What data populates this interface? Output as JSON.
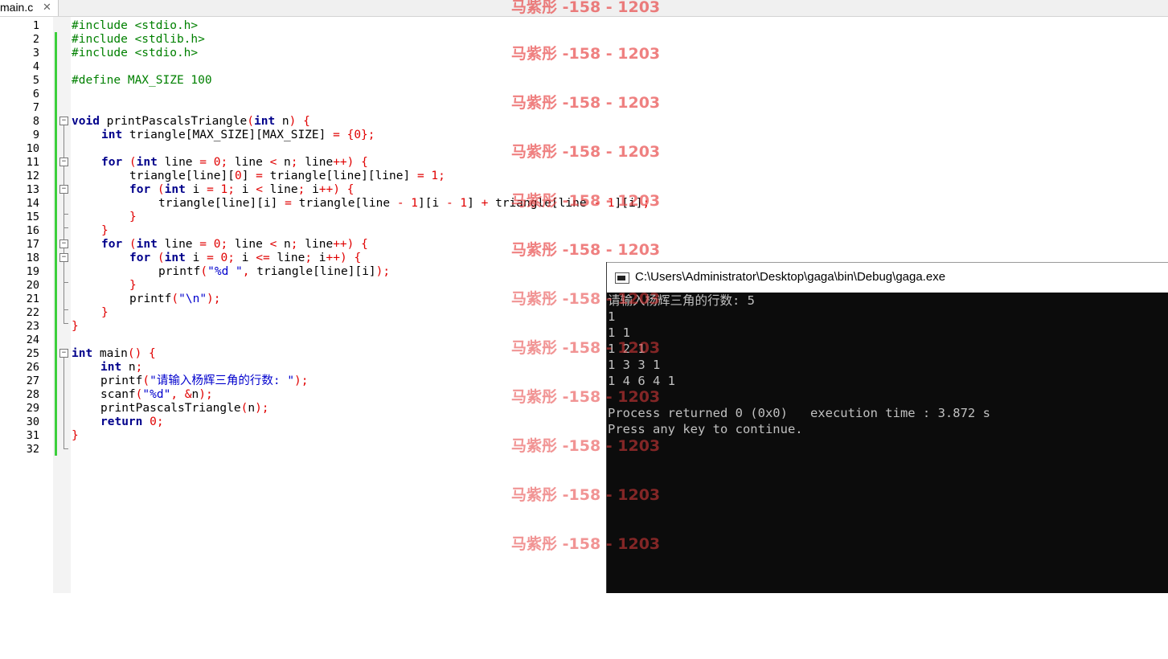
{
  "tab": {
    "filename": "main.c",
    "close": "✕"
  },
  "line_numbers": [
    "1",
    "2",
    "3",
    "4",
    "5",
    "6",
    "7",
    "8",
    "9",
    "10",
    "11",
    "12",
    "13",
    "14",
    "15",
    "16",
    "17",
    "18",
    "19",
    "20",
    "21",
    "22",
    "23",
    "24",
    "25",
    "26",
    "27",
    "28",
    "29",
    "30",
    "31",
    "32"
  ],
  "code": {
    "l1": "#include <stdio.h>",
    "l2": "#include <stdlib.h>",
    "l3": "#include <stdio.h>",
    "l5": "#define MAX_SIZE 100",
    "l8_kw": "void",
    "l8_fn": " printPascalsTriangle",
    "l8_p1": "(",
    "l8_kw2": "int",
    "l8_rest": " n",
    "l8_p2": ") {",
    "l9_kw": "int",
    "l9_a": " triangle[MAX_SIZE][MAX_SIZE] ",
    "l9_b": "= {",
    "l9_n": "0",
    "l9_c": "};",
    "l11_kw": "for",
    "l11_a": " (",
    "l11_kw2": "int",
    "l11_b": " line ",
    "l11_c": "=",
    "l11_n": " 0",
    "l11_d": ";",
    "l11_e": " line ",
    "l11_f": "<",
    "l11_g": " n",
    "l11_h": ";",
    "l11_i": " line",
    "l11_j": "++) {",
    "l12_a": "triangle[line][",
    "l12_n": "0",
    "l12_b": "] ",
    "l12_c": "=",
    "l12_d": " triangle[line][line] ",
    "l12_e": "=",
    "l12_f": " 1",
    "l12_g": ";",
    "l13_kw": "for",
    "l13_a": " (",
    "l13_kw2": "int",
    "l13_b": " i ",
    "l13_c": "=",
    "l13_d": " 1",
    "l13_e": ";",
    "l13_f": " i ",
    "l13_g": "<",
    "l13_h": " line",
    "l13_i": ";",
    "l13_j": " i",
    "l13_k": "++) {",
    "l14_a": "triangle[line][i] ",
    "l14_b": "=",
    "l14_c": " triangle[line ",
    "l14_d": "- 1",
    "l14_e": "][i ",
    "l14_f": "- 1",
    "l14_g": "] ",
    "l14_h": "+",
    "l14_i": " triangle[line ",
    "l14_j": "- 1",
    "l14_k": "][i]",
    "l14_l": ";",
    "l15": "}",
    "l16": "}",
    "l17_kw": "for",
    "l17_a": " (",
    "l17_kw2": "int",
    "l17_b": " line ",
    "l17_c": "=",
    "l17_n": " 0",
    "l17_d": ";",
    "l17_e": " line ",
    "l17_f": "<",
    "l17_g": " n",
    "l17_h": ";",
    "l17_i": " line",
    "l17_j": "++) {",
    "l18_kw": "for",
    "l18_a": " (",
    "l18_kw2": "int",
    "l18_b": " i ",
    "l18_c": "=",
    "l18_d": " 0",
    "l18_e": ";",
    "l18_f": " i ",
    "l18_g": "<=",
    "l18_h": " line",
    "l18_i": ";",
    "l18_j": " i",
    "l18_k": "++) {",
    "l19_a": "printf",
    "l19_b": "(",
    "l19_s": "\"%d \"",
    "l19_c": ",",
    "l19_d": " triangle[line][i]",
    "l19_e": ");",
    "l20": "}",
    "l21_a": "printf",
    "l21_b": "(",
    "l21_s": "\"\\n\"",
    "l21_c": ");",
    "l22": "}",
    "l23": "}",
    "l25_kw": "int",
    "l25_a": " main",
    "l25_b": "() {",
    "l26_kw": "int",
    "l26_a": " n",
    "l26_b": ";",
    "l27_a": "printf",
    "l27_b": "(",
    "l27_s": "\"请输入杨辉三角的行数: \"",
    "l27_c": ");",
    "l28_a": "scanf",
    "l28_b": "(",
    "l28_s": "\"%d\"",
    "l28_c": ", &",
    "l28_d": "n",
    "l28_e": ");",
    "l29_a": "printPascalsTriangle",
    "l29_b": "(",
    "l29_c": "n",
    "l29_d": ");",
    "l30_kw": "return",
    "l30_n": " 0",
    "l30_b": ";",
    "l31": "}"
  },
  "watermark": "马紫彤 -158 - 1203",
  "console": {
    "title": "C:\\Users\\Administrator\\Desktop\\gaga\\bin\\Debug\\gaga.exe",
    "lines": [
      "请输入杨辉三角的行数: 5",
      "1",
      "1 1",
      "1 2 1",
      "1 3 3 1",
      "1 4 6 4 1",
      "",
      "Process returned 0 (0x0)   execution time : 3.872 s",
      "Press any key to continue."
    ]
  }
}
